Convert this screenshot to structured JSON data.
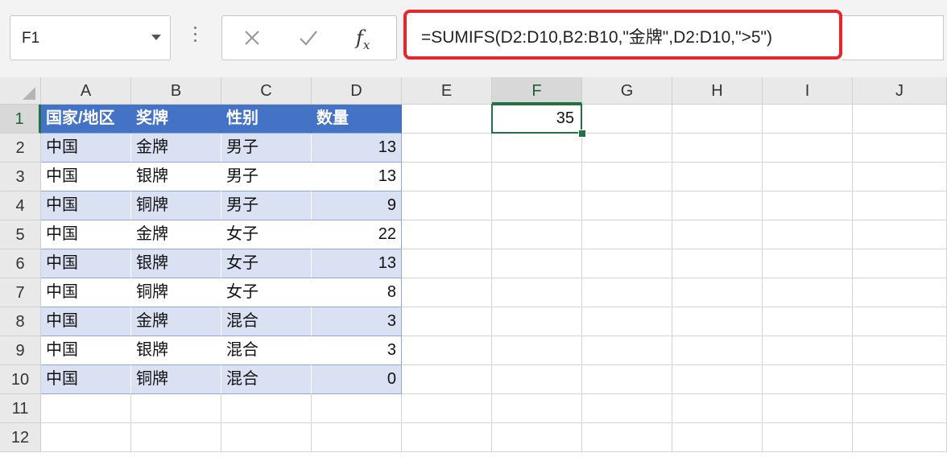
{
  "name_box": {
    "value": "F1"
  },
  "formula_bar": {
    "formula": "=SUMIFS(D2:D10,B2:B10,\"金牌\",D2:D10,\">5\")",
    "highlight_color": "#e8262a"
  },
  "icons": {
    "cancel": "close-icon",
    "enter": "checkmark-icon",
    "function": "fx-icon",
    "fx_label": "f",
    "fx_sub": "x"
  },
  "columns": [
    "A",
    "B",
    "C",
    "D",
    "E",
    "F",
    "G",
    "H",
    "I",
    "J"
  ],
  "rows": [
    "1",
    "2",
    "3",
    "4",
    "5",
    "6",
    "7",
    "8",
    "9",
    "10",
    "11",
    "12"
  ],
  "selected": {
    "column": "F",
    "row": "1"
  },
  "table": {
    "header": [
      "国家/地区",
      "奖牌",
      "性别",
      "数量"
    ],
    "rows": [
      [
        "中国",
        "金牌",
        "男子",
        "13"
      ],
      [
        "中国",
        "银牌",
        "男子",
        "13"
      ],
      [
        "中国",
        "铜牌",
        "男子",
        "9"
      ],
      [
        "中国",
        "金牌",
        "女子",
        "22"
      ],
      [
        "中国",
        "银牌",
        "女子",
        "13"
      ],
      [
        "中国",
        "铜牌",
        "女子",
        "8"
      ],
      [
        "中国",
        "金牌",
        "混合",
        "3"
      ],
      [
        "中国",
        "银牌",
        "混合",
        "3"
      ],
      [
        "中国",
        "铜牌",
        "混合",
        "0"
      ]
    ],
    "header_color": "#4472c4",
    "band_color": "#d9e1f2"
  },
  "result_cell": {
    "address": "F1",
    "value": "35"
  },
  "accent_color": "#217346"
}
